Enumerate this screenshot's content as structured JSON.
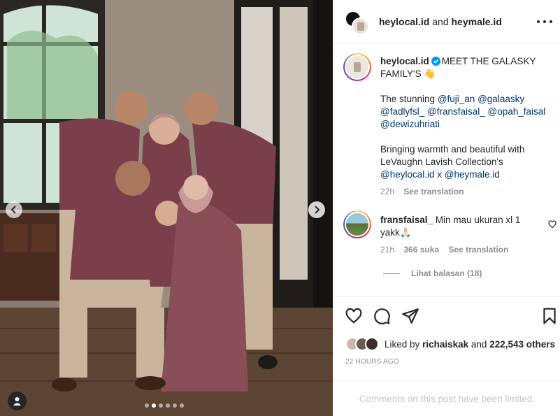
{
  "post": {
    "header": {
      "user1": "heylocal.id",
      "connector": "and",
      "user2": "heymale.id",
      "more_icon": "more-horizontal-icon"
    },
    "photo": {
      "alt_scene": "family-photo",
      "carousel_count": 6,
      "carousel_active_index": 1
    },
    "caption": {
      "username": "heylocal.id",
      "verified": true,
      "text": "MEET THE GALASKY FAMILY'S 👋",
      "line2_prefix": "The stunning",
      "mentions": [
        "@fuji_an",
        "@galaasky",
        "@fadlyfsl_",
        "@fransfaisal_",
        "@opah_faisal",
        "@dewizuhriati"
      ],
      "line3": "Bringing warmth and beautiful with LeVaughn Lavish Collection's",
      "line3_mention1": "@heylocal.id",
      "line3_x": "x",
      "line3_mention2": "@heymale.id",
      "time": "22h",
      "see_translation": "See translation"
    },
    "comment": {
      "username": "fransfaisal_",
      "text": "Min mau ukuran xl 1 yakk🙏🏻",
      "time": "21h",
      "likes": "366 suka",
      "see_translation": "See translation",
      "view_replies": "Lihat balasan (18)"
    },
    "actions": {
      "liked_by_prefix": "Liked by",
      "liked_by_user": "richaiskak",
      "liked_by_and": "and",
      "liked_by_count": "222,543 others",
      "timestamp": "22 HOURS AGO",
      "comments_limited": "Comments on this post have been limited."
    }
  },
  "colors": {
    "accent_link": "#00376b",
    "muted": "#8e8e8e",
    "verified": "#0095f6",
    "outfit": "#7a3f4a"
  }
}
